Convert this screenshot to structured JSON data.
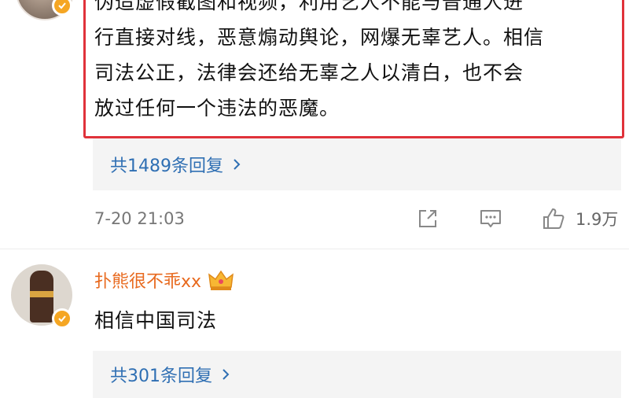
{
  "comment1": {
    "lines": [
      "伪造虚假截图和视频，利用艺人不能与普通人进",
      "行直接对线，恶意煽动舆论，网爆无辜艺人。相信",
      "司法公正，法律会还给无辜之人以清白，也不会",
      "放过任何一个违法的恶魔。"
    ],
    "replies_label": "共1489条回复",
    "timestamp": "7-20 21:03",
    "like_count": "1.9万"
  },
  "comment2": {
    "username": "扑熊很不乖xx",
    "text": "相信中国司法",
    "replies_label": "共301条回复"
  },
  "icons": {
    "share": "share-icon",
    "comment": "comment-icon",
    "like": "thumbs-up-icon",
    "verified": "verified-badge-icon",
    "crown": "crown-icon",
    "chevron": "chevron-right-icon"
  },
  "colors": {
    "highlight_border": "#e0323a",
    "link": "#2f6fb3",
    "username": "#e86a1f",
    "verified_badge": "#f5a623"
  }
}
